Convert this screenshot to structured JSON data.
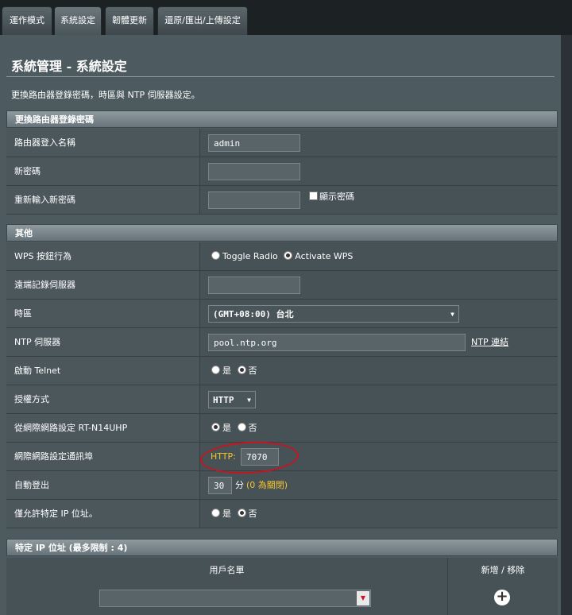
{
  "tabs": [
    "運作模式",
    "系統設定",
    "韌體更新",
    "還原/匯出/上傳設定"
  ],
  "page": {
    "title": "系統管理 - 系統設定",
    "description": "更換路由器登錄密碼，時區與 NTP 伺服器設定。"
  },
  "password_section": {
    "title": "更換路由器登錄密碼",
    "rows": {
      "login_name": {
        "label": "路由器登入名稱",
        "value": "admin"
      },
      "new_password": {
        "label": "新密碼",
        "value": ""
      },
      "confirm_password": {
        "label": "重新輸入新密碼",
        "value": "",
        "show_label": "顯示密碼"
      }
    }
  },
  "misc_section": {
    "title": "其他",
    "wps": {
      "label": "WPS 按鈕行為",
      "option1": "Toggle Radio",
      "option2": "Activate WPS"
    },
    "syslog": {
      "label": "遠端記錄伺服器",
      "value": ""
    },
    "timezone": {
      "label": "時區",
      "value": "(GMT+08:00) 台北"
    },
    "ntp": {
      "label": "NTP 伺服器",
      "value": "pool.ntp.org",
      "link": "NTP 連結"
    },
    "telnet": {
      "label": "啟動 Telnet",
      "yes": "是",
      "no": "否"
    },
    "auth": {
      "label": "授權方式",
      "value": "HTTP"
    },
    "wan_access": {
      "label": "從網際網路設定 RT-N14UHP",
      "yes": "是",
      "no": "否"
    },
    "port": {
      "label": "網際網路設定通訊埠",
      "prefix": "HTTP:",
      "value": "7070"
    },
    "logout": {
      "label": "自動登出",
      "value": "30",
      "unit": "分",
      "note": "(0 為關閉)"
    },
    "ip_only": {
      "label": "僅允許特定 IP 位址。",
      "yes": "是",
      "no": "否"
    }
  },
  "ip_section": {
    "title": "特定 IP 位址 (最多限制 : 4)",
    "col_client": "用戶名單",
    "col_action": "新增 / 移除"
  }
}
